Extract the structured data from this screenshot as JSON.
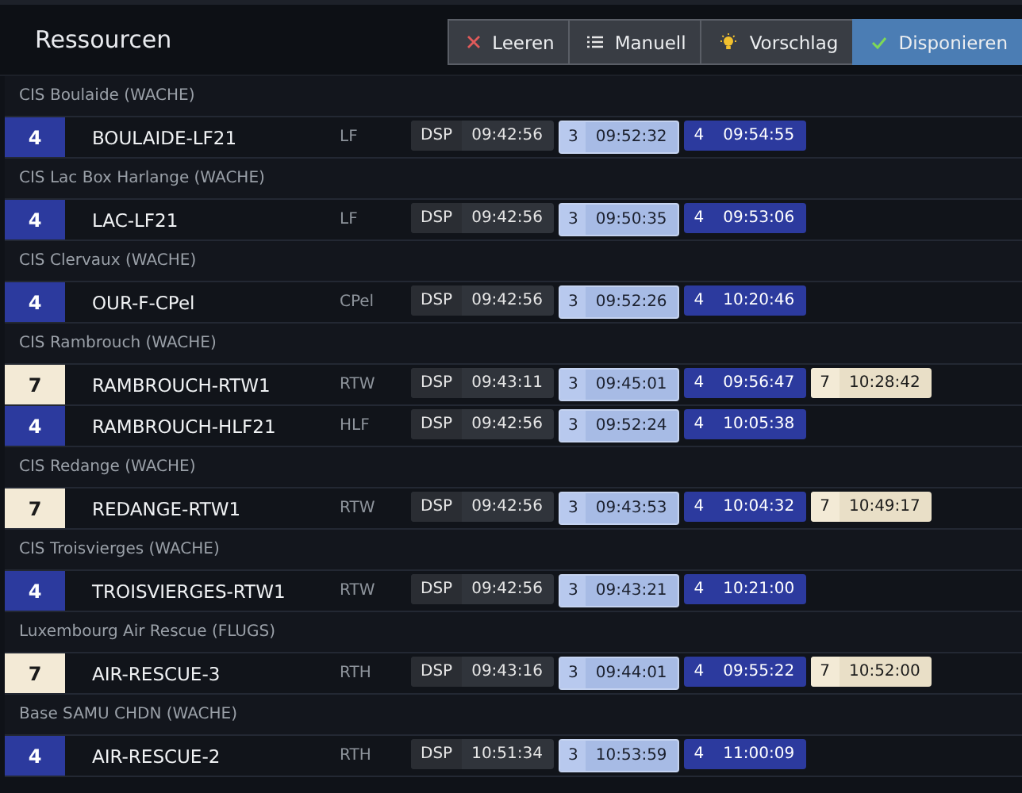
{
  "header": {
    "title": "Ressourcen",
    "buttons": [
      {
        "label": "Leeren",
        "selected": false
      },
      {
        "label": "Manuell",
        "selected": false
      },
      {
        "label": "Vorschlag",
        "selected": false
      },
      {
        "label": "Disponieren",
        "selected": true
      }
    ]
  },
  "groups": [
    {
      "name": "CIS Boulaide (WACHE)",
      "units": [
        {
          "status": "4",
          "kind": "s4",
          "name": "BOULAIDE-LF21",
          "type": "LF",
          "times": [
            {
              "kind": "dsp",
              "label": "DSP",
              "time": "09:42:56"
            },
            {
              "kind": "s3",
              "label": "3",
              "time": "09:52:32"
            },
            {
              "kind": "s4",
              "label": "4",
              "time": "09:54:55"
            }
          ]
        }
      ]
    },
    {
      "name": "CIS Lac Box Harlange (WACHE)",
      "units": [
        {
          "status": "4",
          "kind": "s4",
          "name": "LAC-LF21",
          "type": "LF",
          "times": [
            {
              "kind": "dsp",
              "label": "DSP",
              "time": "09:42:56"
            },
            {
              "kind": "s3",
              "label": "3",
              "time": "09:50:35"
            },
            {
              "kind": "s4",
              "label": "4",
              "time": "09:53:06"
            }
          ]
        }
      ]
    },
    {
      "name": "CIS Clervaux (WACHE)",
      "units": [
        {
          "status": "4",
          "kind": "s4",
          "name": "OUR-F-CPel",
          "type": "CPel",
          "times": [
            {
              "kind": "dsp",
              "label": "DSP",
              "time": "09:42:56"
            },
            {
              "kind": "s3",
              "label": "3",
              "time": "09:52:26"
            },
            {
              "kind": "s4",
              "label": "4",
              "time": "10:20:46"
            }
          ]
        }
      ]
    },
    {
      "name": "CIS Rambrouch (WACHE)",
      "units": [
        {
          "status": "7",
          "kind": "s7",
          "name": "RAMBROUCH-RTW1",
          "type": "RTW",
          "times": [
            {
              "kind": "dsp",
              "label": "DSP",
              "time": "09:43:11"
            },
            {
              "kind": "s3",
              "label": "3",
              "time": "09:45:01"
            },
            {
              "kind": "s4",
              "label": "4",
              "time": "09:56:47"
            },
            {
              "kind": "s7",
              "label": "7",
              "time": "10:28:42"
            }
          ]
        },
        {
          "status": "4",
          "kind": "s4",
          "name": "RAMBROUCH-HLF21",
          "type": "HLF",
          "times": [
            {
              "kind": "dsp",
              "label": "DSP",
              "time": "09:42:56"
            },
            {
              "kind": "s3",
              "label": "3",
              "time": "09:52:24"
            },
            {
              "kind": "s4",
              "label": "4",
              "time": "10:05:38"
            }
          ]
        }
      ]
    },
    {
      "name": "CIS Redange (WACHE)",
      "units": [
        {
          "status": "7",
          "kind": "s7",
          "name": "REDANGE-RTW1",
          "type": "RTW",
          "times": [
            {
              "kind": "dsp",
              "label": "DSP",
              "time": "09:42:56"
            },
            {
              "kind": "s3",
              "label": "3",
              "time": "09:43:53"
            },
            {
              "kind": "s4",
              "label": "4",
              "time": "10:04:32"
            },
            {
              "kind": "s7",
              "label": "7",
              "time": "10:49:17"
            }
          ]
        }
      ]
    },
    {
      "name": "CIS Troisvierges (WACHE)",
      "units": [
        {
          "status": "4",
          "kind": "s4",
          "name": "TROISVIERGES-RTW1",
          "type": "RTW",
          "times": [
            {
              "kind": "dsp",
              "label": "DSP",
              "time": "09:42:56"
            },
            {
              "kind": "s3",
              "label": "3",
              "time": "09:43:21"
            },
            {
              "kind": "s4",
              "label": "4",
              "time": "10:21:00"
            }
          ]
        }
      ]
    },
    {
      "name": "Luxembourg Air Rescue (FLUGS)",
      "units": [
        {
          "status": "7",
          "kind": "s7",
          "name": "AIR-RESCUE-3",
          "type": "RTH",
          "times": [
            {
              "kind": "dsp",
              "label": "DSP",
              "time": "09:43:16"
            },
            {
              "kind": "s3",
              "label": "3",
              "time": "09:44:01"
            },
            {
              "kind": "s4",
              "label": "4",
              "time": "09:55:22"
            },
            {
              "kind": "s7",
              "label": "7",
              "time": "10:52:00"
            }
          ]
        }
      ]
    },
    {
      "name": "Base SAMU CHDN (WACHE)",
      "units": [
        {
          "status": "4",
          "kind": "s4",
          "name": "AIR-RESCUE-2",
          "type": "RTH",
          "times": [
            {
              "kind": "dsp",
              "label": "DSP",
              "time": "10:51:34"
            },
            {
              "kind": "s3",
              "label": "3",
              "time": "10:53:59"
            },
            {
              "kind": "s4",
              "label": "4",
              "time": "11:00:09"
            }
          ]
        }
      ]
    }
  ]
}
